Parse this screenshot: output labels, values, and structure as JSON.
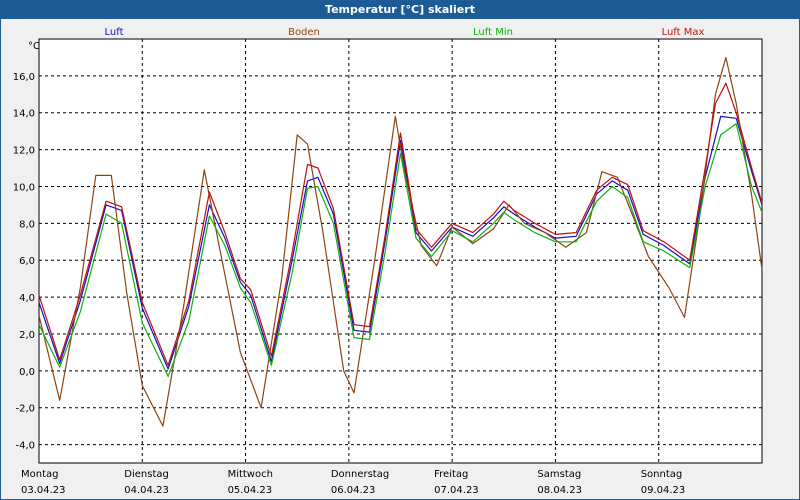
{
  "window": {
    "title": "Temperatur [°C] skaliert"
  },
  "chart_data": {
    "type": "line",
    "title": "Temperatur [°C] skaliert",
    "ylabel": "°C",
    "ylim": [
      -5,
      18
    ],
    "xlim": [
      0,
      7
    ],
    "grid": true,
    "yticks": [
      -4,
      -2,
      0,
      2,
      4,
      6,
      8,
      10,
      12,
      14,
      16
    ],
    "ytick_labels": [
      "-4,0",
      "-2,0",
      "0,0",
      "2,0",
      "4,0",
      "6,0",
      "8,0",
      "10,0",
      "12,0",
      "14,0",
      "16,0"
    ],
    "x_days": [
      {
        "day": "Montag",
        "date": "03.04.23"
      },
      {
        "day": "Dienstag",
        "date": "04.04.23"
      },
      {
        "day": "Mittwoch",
        "date": "05.04.23"
      },
      {
        "day": "Donnerstag",
        "date": "06.04.23"
      },
      {
        "day": "Freitag",
        "date": "07.04.23"
      },
      {
        "day": "Samstag",
        "date": "08.04.23"
      },
      {
        "day": "Sonntag",
        "date": "09.04.23"
      }
    ],
    "series": [
      {
        "name": "Luft",
        "color": "#1010c8",
        "points": [
          [
            0,
            3.7
          ],
          [
            0.2,
            0.4
          ],
          [
            0.4,
            3.8
          ],
          [
            0.65,
            9.0
          ],
          [
            0.8,
            8.7
          ],
          [
            1.0,
            3.4
          ],
          [
            1.25,
            0.1
          ],
          [
            1.45,
            3.5
          ],
          [
            1.65,
            9.0
          ],
          [
            1.8,
            7.2
          ],
          [
            1.95,
            4.8
          ],
          [
            2.05,
            4.1
          ],
          [
            2.25,
            0.5
          ],
          [
            2.45,
            6.0
          ],
          [
            2.6,
            10.3
          ],
          [
            2.7,
            10.5
          ],
          [
            2.85,
            8.5
          ],
          [
            3.05,
            2.2
          ],
          [
            3.2,
            2.1
          ],
          [
            3.35,
            7.0
          ],
          [
            3.5,
            12.5
          ],
          [
            3.65,
            7.5
          ],
          [
            3.8,
            6.5
          ],
          [
            4.0,
            7.8
          ],
          [
            4.2,
            7.3
          ],
          [
            4.4,
            8.3
          ],
          [
            4.5,
            8.9
          ],
          [
            4.6,
            8.5
          ],
          [
            4.8,
            7.8
          ],
          [
            5.0,
            7.2
          ],
          [
            5.2,
            7.3
          ],
          [
            5.4,
            9.6
          ],
          [
            5.55,
            10.3
          ],
          [
            5.7,
            9.8
          ],
          [
            5.85,
            7.4
          ],
          [
            6.05,
            6.8
          ],
          [
            6.3,
            5.8
          ],
          [
            6.45,
            10.5
          ],
          [
            6.6,
            13.8
          ],
          [
            6.75,
            13.7
          ],
          [
            6.9,
            10.8
          ],
          [
            7.0,
            9.0
          ]
        ]
      },
      {
        "name": "Boden",
        "color": "#8b4513",
        "points": [
          [
            0,
            3.0
          ],
          [
            0.2,
            -1.6
          ],
          [
            0.4,
            4.5
          ],
          [
            0.55,
            10.6
          ],
          [
            0.7,
            10.6
          ],
          [
            0.85,
            4.2
          ],
          [
            1.0,
            -0.8
          ],
          [
            1.2,
            -3.0
          ],
          [
            1.4,
            3.5
          ],
          [
            1.6,
            10.9
          ],
          [
            1.75,
            6.6
          ],
          [
            1.95,
            1.0
          ],
          [
            2.15,
            -2.0
          ],
          [
            2.35,
            5.0
          ],
          [
            2.5,
            12.8
          ],
          [
            2.6,
            12.3
          ],
          [
            2.75,
            7.5
          ],
          [
            2.95,
            0.0
          ],
          [
            3.05,
            -1.2
          ],
          [
            3.25,
            6.0
          ],
          [
            3.45,
            13.8
          ],
          [
            3.55,
            10.5
          ],
          [
            3.7,
            6.8
          ],
          [
            3.85,
            5.7
          ],
          [
            4.0,
            7.8
          ],
          [
            4.2,
            6.9
          ],
          [
            4.4,
            7.7
          ],
          [
            4.55,
            9.0
          ],
          [
            4.7,
            8.0
          ],
          [
            4.9,
            7.5
          ],
          [
            5.1,
            6.7
          ],
          [
            5.3,
            7.5
          ],
          [
            5.45,
            10.8
          ],
          [
            5.6,
            10.5
          ],
          [
            5.75,
            8.4
          ],
          [
            5.9,
            6.2
          ],
          [
            6.1,
            4.5
          ],
          [
            6.25,
            2.9
          ],
          [
            6.4,
            8.5
          ],
          [
            6.55,
            15.0
          ],
          [
            6.65,
            17.0
          ],
          [
            6.75,
            14.5
          ],
          [
            6.9,
            9.5
          ],
          [
            7.0,
            5.5
          ]
        ]
      },
      {
        "name": "Luft Min",
        "color": "#10b010",
        "points": [
          [
            0,
            2.5
          ],
          [
            0.2,
            0.2
          ],
          [
            0.4,
            3.2
          ],
          [
            0.65,
            8.5
          ],
          [
            0.8,
            8.0
          ],
          [
            1.0,
            2.6
          ],
          [
            1.25,
            -0.3
          ],
          [
            1.45,
            2.7
          ],
          [
            1.65,
            8.4
          ],
          [
            1.8,
            6.8
          ],
          [
            1.95,
            4.5
          ],
          [
            2.05,
            3.7
          ],
          [
            2.25,
            0.3
          ],
          [
            2.45,
            5.3
          ],
          [
            2.6,
            9.9
          ],
          [
            2.7,
            10.0
          ],
          [
            2.85,
            8.0
          ],
          [
            3.05,
            1.8
          ],
          [
            3.2,
            1.7
          ],
          [
            3.35,
            6.4
          ],
          [
            3.5,
            11.8
          ],
          [
            3.65,
            7.2
          ],
          [
            3.8,
            6.2
          ],
          [
            4.0,
            7.6
          ],
          [
            4.2,
            7.0
          ],
          [
            4.4,
            8.0
          ],
          [
            4.5,
            8.6
          ],
          [
            4.6,
            8.2
          ],
          [
            4.8,
            7.5
          ],
          [
            5.0,
            7.0
          ],
          [
            5.2,
            7.0
          ],
          [
            5.4,
            9.2
          ],
          [
            5.55,
            10.0
          ],
          [
            5.7,
            9.4
          ],
          [
            5.85,
            7.0
          ],
          [
            6.05,
            6.5
          ],
          [
            6.3,
            5.6
          ],
          [
            6.45,
            10.0
          ],
          [
            6.6,
            12.8
          ],
          [
            6.75,
            13.4
          ],
          [
            6.9,
            10.0
          ],
          [
            7.0,
            8.6
          ]
        ]
      },
      {
        "name": "Luft Max",
        "color": "#c01010",
        "points": [
          [
            0,
            4.1
          ],
          [
            0.2,
            0.6
          ],
          [
            0.4,
            4.1
          ],
          [
            0.65,
            9.2
          ],
          [
            0.8,
            8.9
          ],
          [
            1.0,
            3.7
          ],
          [
            1.25,
            0.3
          ],
          [
            1.45,
            3.8
          ],
          [
            1.65,
            9.7
          ],
          [
            1.8,
            7.5
          ],
          [
            1.95,
            5.0
          ],
          [
            2.05,
            4.4
          ],
          [
            2.25,
            0.8
          ],
          [
            2.45,
            6.4
          ],
          [
            2.6,
            11.2
          ],
          [
            2.7,
            11.0
          ],
          [
            2.85,
            8.8
          ],
          [
            3.05,
            2.5
          ],
          [
            3.2,
            2.4
          ],
          [
            3.35,
            7.3
          ],
          [
            3.5,
            12.9
          ],
          [
            3.65,
            7.7
          ],
          [
            3.8,
            6.7
          ],
          [
            4.0,
            8.0
          ],
          [
            4.2,
            7.5
          ],
          [
            4.4,
            8.5
          ],
          [
            4.5,
            9.2
          ],
          [
            4.6,
            8.7
          ],
          [
            4.8,
            8.0
          ],
          [
            5.0,
            7.4
          ],
          [
            5.2,
            7.5
          ],
          [
            5.4,
            9.8
          ],
          [
            5.55,
            10.5
          ],
          [
            5.7,
            10.1
          ],
          [
            5.85,
            7.6
          ],
          [
            6.05,
            7.0
          ],
          [
            6.3,
            6.0
          ],
          [
            6.45,
            11.0
          ],
          [
            6.55,
            14.5
          ],
          [
            6.65,
            15.6
          ],
          [
            6.75,
            14.0
          ],
          [
            6.9,
            11.0
          ],
          [
            7.0,
            9.1
          ]
        ]
      }
    ]
  }
}
